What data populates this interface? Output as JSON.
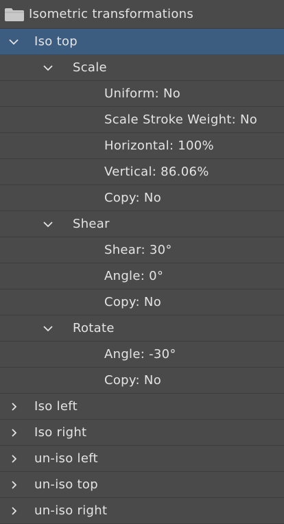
{
  "set": {
    "name": "Isometric transformations",
    "icon": "folder-icon"
  },
  "actions": [
    {
      "label": "Iso top",
      "expanded": true,
      "selected": true,
      "steps": [
        {
          "label": "Scale",
          "expanded": true,
          "params": [
            "Uniform: No",
            "Scale Stroke Weight: No",
            "Horizontal: 100%",
            "Vertical: 86.06%",
            "Copy: No"
          ]
        },
        {
          "label": "Shear",
          "expanded": true,
          "params": [
            "Shear: 30°",
            "Angle: 0°",
            "Copy: No"
          ]
        },
        {
          "label": "Rotate",
          "expanded": true,
          "params": [
            "Angle: -30°",
            "Copy: No"
          ]
        }
      ]
    },
    {
      "label": "Iso left",
      "expanded": false
    },
    {
      "label": "Iso right",
      "expanded": false
    },
    {
      "label": "un-iso left",
      "expanded": false
    },
    {
      "label": "un-iso top",
      "expanded": false
    },
    {
      "label": "un-iso right",
      "expanded": false
    }
  ],
  "colors": {
    "panel_bg": "#4a4a4a",
    "selected_bg": "#3c5c80",
    "text": "#e4e4e4",
    "divider": "#3d3d3d"
  }
}
